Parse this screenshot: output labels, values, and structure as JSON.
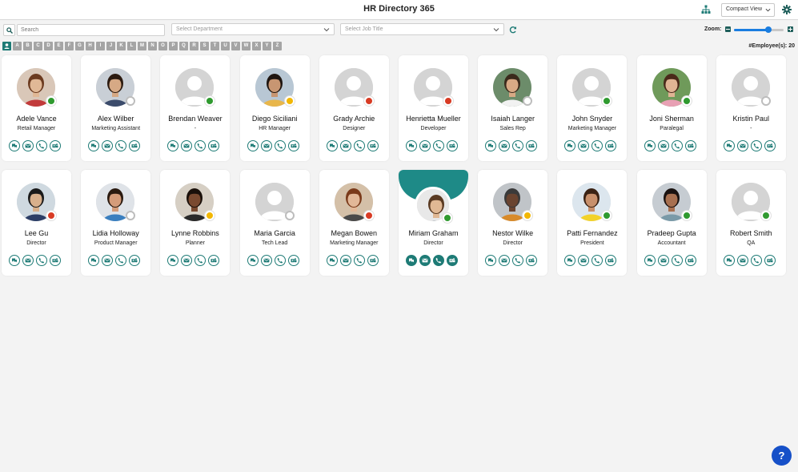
{
  "app": {
    "title": "HR Directory 365",
    "view_select": "Compact View"
  },
  "filters": {
    "search_placeholder": "Search",
    "department_placeholder": "Select Department",
    "job_title_placeholder": "Select Job Title",
    "zoom_label": "Zoom:",
    "zoom_level": 0.7
  },
  "alphabet": [
    "A",
    "B",
    "C",
    "D",
    "E",
    "F",
    "G",
    "H",
    "I",
    "J",
    "K",
    "L",
    "M",
    "N",
    "O",
    "P",
    "Q",
    "R",
    "S",
    "T",
    "U",
    "V",
    "W",
    "X",
    "Y",
    "Z"
  ],
  "employee_count": "#Employee(s): 20",
  "colors": {
    "accent": "#1e7b76",
    "online": "#2f9a2f",
    "busy": "#d83b24",
    "away": "#f2b704",
    "help": "#1650c8"
  },
  "employees": [
    {
      "name": "Adele Vance",
      "title": "Retail Manager",
      "presence": "online",
      "photo": "photo",
      "skin": "#e0b896",
      "hair": "#6b3a1f",
      "bg": "#d9c7b8",
      "shirt": "#c23b3b"
    },
    {
      "name": "Alex Wilber",
      "title": "Marketing Assistant",
      "presence": "offline",
      "photo": "photo",
      "skin": "#d6a985",
      "hair": "#2b1a10",
      "bg": "#c9cfd6",
      "shirt": "#3b4b6b"
    },
    {
      "name": "Brendan Weaver",
      "title": "-",
      "presence": "online",
      "photo": "placeholder"
    },
    {
      "name": "Diego Siciliani",
      "title": "HR Manager",
      "presence": "away",
      "photo": "photo",
      "skin": "#c89672",
      "hair": "#1e1510",
      "bg": "#b8c7d4",
      "shirt": "#e8b64a"
    },
    {
      "name": "Grady Archie",
      "title": "Designer",
      "presence": "busy",
      "photo": "placeholder"
    },
    {
      "name": "Henrietta Mueller",
      "title": "Developer",
      "presence": "busy",
      "photo": "placeholder"
    },
    {
      "name": "Isaiah Langer",
      "title": "Sales Rep",
      "presence": "offline",
      "photo": "photo",
      "skin": "#d8a985",
      "hair": "#3a2a1c",
      "bg": "#6c8c6a",
      "shirt": "#f2f2f2"
    },
    {
      "name": "John Snyder",
      "title": "Marketing Manager",
      "presence": "online",
      "photo": "placeholder"
    },
    {
      "name": "Joni Sherman",
      "title": "Paralegal",
      "presence": "online",
      "photo": "photo",
      "skin": "#e0b494",
      "hair": "#4a2a1a",
      "bg": "#6f9a5a",
      "shirt": "#e8a0b4"
    },
    {
      "name": "Kristin Paul",
      "title": "-",
      "presence": "offline",
      "photo": "placeholder"
    },
    {
      "name": "Lee Gu",
      "title": "Director",
      "presence": "busy",
      "photo": "photo",
      "skin": "#d8b08c",
      "hair": "#1a1a1a",
      "bg": "#cfd9e0",
      "shirt": "#2c3e66"
    },
    {
      "name": "Lidia Holloway",
      "title": "Product Manager",
      "presence": "offline",
      "photo": "photo",
      "skin": "#d49c7a",
      "hair": "#2a1a10",
      "bg": "#dfe3e8",
      "shirt": "#3a7fbf"
    },
    {
      "name": "Lynne Robbins",
      "title": "Planner",
      "presence": "away",
      "photo": "photo",
      "skin": "#7a4a30",
      "hair": "#1a100a",
      "bg": "#d6cfc4",
      "shirt": "#2a2a2a"
    },
    {
      "name": "Maria Garcia",
      "title": "Tech Lead",
      "presence": "offline",
      "photo": "placeholder"
    },
    {
      "name": "Megan Bowen",
      "title": "Marketing Manager",
      "presence": "busy",
      "photo": "photo",
      "skin": "#e2b898",
      "hair": "#7a3a1a",
      "bg": "#d4c0a8",
      "shirt": "#4a4a4a"
    },
    {
      "name": "Miriam Graham",
      "title": "Director",
      "presence": "online",
      "photo": "photo",
      "skin": "#e0b894",
      "hair": "#5a3a22",
      "bg": "#e8e8e8",
      "shirt": "#5a6a7a",
      "selected": true
    },
    {
      "name": "Nestor Wilke",
      "title": "Director",
      "presence": "away",
      "photo": "photo",
      "skin": "#6a4430",
      "hair": "#3a3a3a",
      "bg": "#c0c4c8",
      "shirt": "#d88a2a"
    },
    {
      "name": "Patti Fernandez",
      "title": "President",
      "presence": "online",
      "photo": "photo",
      "skin": "#c8906c",
      "hair": "#3a2214",
      "bg": "#dce6ee",
      "shirt": "#f2d22a"
    },
    {
      "name": "Pradeep Gupta",
      "title": "Accountant",
      "presence": "online",
      "photo": "photo",
      "skin": "#a87050",
      "hair": "#1a1210",
      "bg": "#c6ccd2",
      "shirt": "#7a9aa8"
    },
    {
      "name": "Robert Smith",
      "title": "QA",
      "presence": "online",
      "photo": "placeholder"
    }
  ],
  "actions": [
    {
      "id": "chat",
      "icon": "chat-icon"
    },
    {
      "id": "mail",
      "icon": "mail-icon"
    },
    {
      "id": "call",
      "icon": "phone-icon"
    },
    {
      "id": "teams",
      "icon": "teams-icon"
    }
  ],
  "help_label": "?"
}
